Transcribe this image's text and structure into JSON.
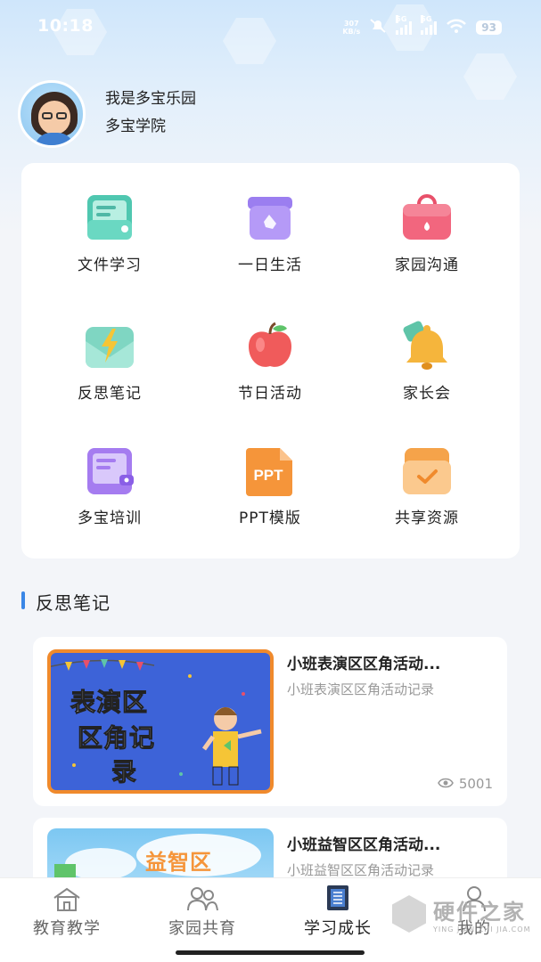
{
  "status_bar": {
    "time": "10:18",
    "net_speed_value": "307",
    "net_speed_unit": "KB/s",
    "sig1_label": "5G",
    "sig2_label": "5G",
    "battery": "93"
  },
  "profile": {
    "name": "我是多宝乐园",
    "school": "多宝学院"
  },
  "grid": {
    "items": [
      {
        "label": "文件学习",
        "icon": "file-study-icon"
      },
      {
        "label": "一日生活",
        "icon": "daily-life-icon"
      },
      {
        "label": "家园沟通",
        "icon": "home-communication-icon"
      },
      {
        "label": "反思笔记",
        "icon": "reflection-notes-icon"
      },
      {
        "label": "节日活动",
        "icon": "apple-icon"
      },
      {
        "label": "家长会",
        "icon": "bell-icon"
      },
      {
        "label": "多宝培训",
        "icon": "training-icon"
      },
      {
        "label": "PPT模版",
        "icon": "ppt-icon"
      },
      {
        "label": "共享资源",
        "icon": "shared-resources-icon"
      }
    ],
    "ppt_icon_text": "PPT"
  },
  "section": {
    "title": "反思笔记"
  },
  "articles": [
    {
      "title": "小班表演区区角活动...",
      "subtitle": "小班表演区区角活动记录",
      "thumb_text_1": "表演区",
      "thumb_text_2": "区角记",
      "thumb_text_3": "录",
      "views": "5001"
    },
    {
      "title": "小班益智区区角活动...",
      "subtitle": "小班益智区区角活动记录",
      "thumb_text_1": "益智区"
    }
  ],
  "tabbar": {
    "tabs": [
      {
        "label": "教育教学",
        "icon": "school-icon",
        "active": false
      },
      {
        "label": "家园共育",
        "icon": "people-icon",
        "active": false
      },
      {
        "label": "学习成长",
        "icon": "book-icon",
        "active": true
      },
      {
        "label": "我的",
        "icon": "user-icon",
        "active": false
      }
    ]
  },
  "watermark": {
    "title": "硬件之家",
    "subtitle": "YING JIAN ZHI JIA.COM"
  },
  "colors": {
    "accent": "#3a86e6",
    "thumb_blue": "#3d63d8",
    "thumb_border": "#f08a2c"
  }
}
